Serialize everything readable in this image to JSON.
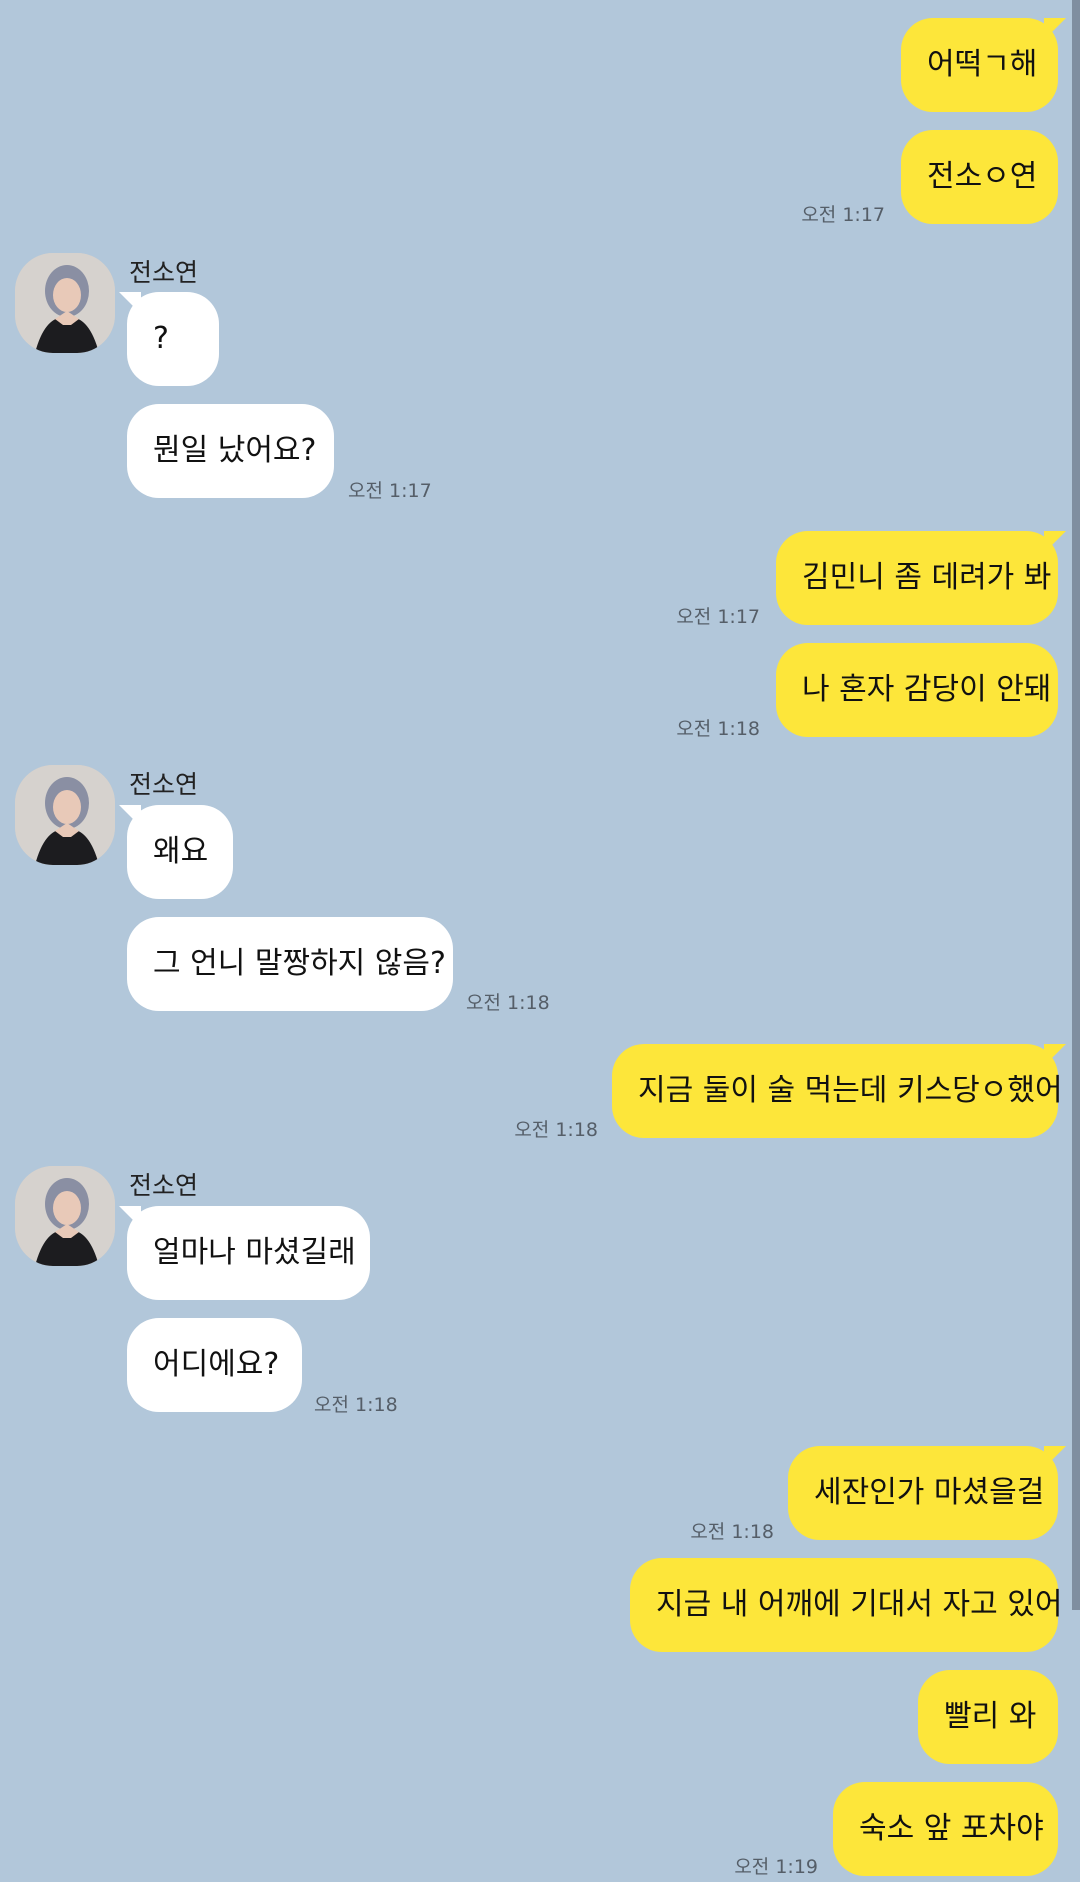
{
  "messages": [
    {
      "sender": "me",
      "text": "어떡ㄱ해",
      "time": ""
    },
    {
      "sender": "me",
      "text": "전소ㅇ연",
      "time": "오전 1:17"
    },
    {
      "sender": "them",
      "name": "전소연",
      "text": "?",
      "time": ""
    },
    {
      "sender": "them",
      "text": "뭔일 났어요?",
      "time": "오전 1:17"
    },
    {
      "sender": "me",
      "text": "김민니 좀 데려가 봐",
      "time": "오전 1:17"
    },
    {
      "sender": "me",
      "text": "나 혼자 감당이 안돼",
      "time": "오전 1:18"
    },
    {
      "sender": "them",
      "name": "전소연",
      "text": "왜요",
      "time": ""
    },
    {
      "sender": "them",
      "text": "그 언니 말짱하지 않음?",
      "time": "오전 1:18"
    },
    {
      "sender": "me",
      "text": "지금 둘이 술 먹는데 키스당ㅇ했어",
      "time": "오전 1:18"
    },
    {
      "sender": "them",
      "name": "전소연",
      "text": "얼마나 마셨길래",
      "time": ""
    },
    {
      "sender": "them",
      "text": "어디에요?",
      "time": "오전 1:18"
    },
    {
      "sender": "me",
      "text": "세잔인가 마셨을걸",
      "time": "오전 1:18"
    },
    {
      "sender": "me",
      "text": "지금 내 어깨에 기대서 자고 있어",
      "time": ""
    },
    {
      "sender": "me",
      "text": "빨리 와",
      "time": ""
    },
    {
      "sender": "me",
      "text": "숙소 앞 포차야",
      "time": "오전 1:19"
    }
  ],
  "colors": {
    "background": "#b2c7da",
    "my_bubble": "#fde63a",
    "their_bubble": "#ffffff"
  },
  "icons": {
    "avatar": "profile-photo"
  }
}
